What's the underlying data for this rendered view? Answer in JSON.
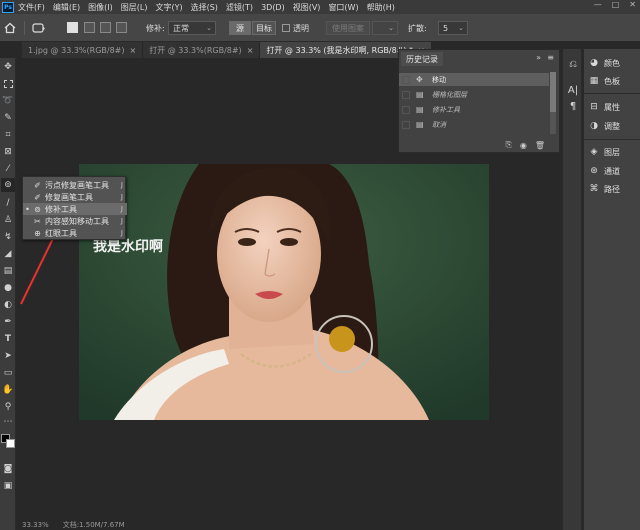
{
  "menubar": {
    "logo": "Ps",
    "items": [
      "文件(F)",
      "编辑(E)",
      "图像(I)",
      "图层(L)",
      "文字(Y)",
      "选择(S)",
      "滤镜(T)",
      "3D(D)",
      "视图(V)",
      "窗口(W)",
      "帮助(H)"
    ]
  },
  "options": {
    "repair_label": "修补:",
    "repair_value": "正常",
    "source_label": "源",
    "target_label": "目标",
    "transparent_label": "透明",
    "use_pattern_label": "使用图案",
    "diffusion_label": "扩散:",
    "diffusion_value": "5"
  },
  "tabs": [
    {
      "label": "1.jpg @ 33.3%(RGB/8#)",
      "close": "×"
    },
    {
      "label": "打开 @ 33.3%(RGB/8#)",
      "close": "×"
    },
    {
      "label": "打开 @ 33.3% (我是水印啊, RGB/8#) *",
      "close": "×"
    }
  ],
  "canvas": {
    "watermark_text": "我是水印啊"
  },
  "flyout": {
    "items": [
      {
        "label": "污点修复画笔工具",
        "key": "J",
        "icon": "spot-healing-icon"
      },
      {
        "label": "修复画笔工具",
        "key": "J",
        "icon": "healing-brush-icon"
      },
      {
        "label": "修补工具",
        "key": "J",
        "icon": "patch-icon",
        "bullet": "•"
      },
      {
        "label": "内容感知移动工具",
        "key": "J",
        "icon": "content-aware-move-icon"
      },
      {
        "label": "红眼工具",
        "key": "J",
        "icon": "red-eye-icon"
      }
    ]
  },
  "history": {
    "title": "历史记录",
    "items": [
      {
        "label": "移动",
        "active": true
      },
      {
        "label": "栅格化图层",
        "active": false
      },
      {
        "label": "修补工具",
        "active": false
      },
      {
        "label": "取消",
        "active": false
      }
    ]
  },
  "right_panel": {
    "items": [
      "颜色",
      "色板",
      "属性",
      "调整",
      "图层",
      "通道",
      "路径"
    ]
  },
  "status": {
    "zoom": "33.33%",
    "doc": "文档:1.50M/7.67M"
  },
  "colors": {
    "accent": "#31a8ff",
    "photo_bg": "#2f5035",
    "arrow_red": "#e8322e"
  }
}
